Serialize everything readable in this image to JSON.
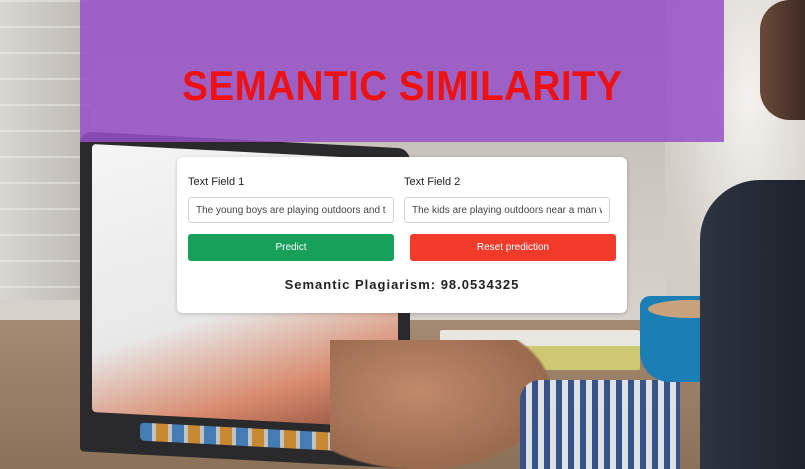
{
  "header": {
    "title": "SEMANTIC SIMILARITY"
  },
  "form": {
    "field1": {
      "label": "Text Field 1",
      "value": "The young boys are playing outdoors and the m"
    },
    "field2": {
      "label": "Text Field 2",
      "value": "The kids are playing outdoors near a man with a"
    },
    "predict_label": "Predict",
    "reset_label": "Reset prediction",
    "result_text": "Semantic Plagiarism: 98.0534325"
  },
  "colors": {
    "banner": "#9650c8",
    "title": "#ee1111",
    "predict": "#16a05a",
    "reset": "#f23a2a"
  }
}
